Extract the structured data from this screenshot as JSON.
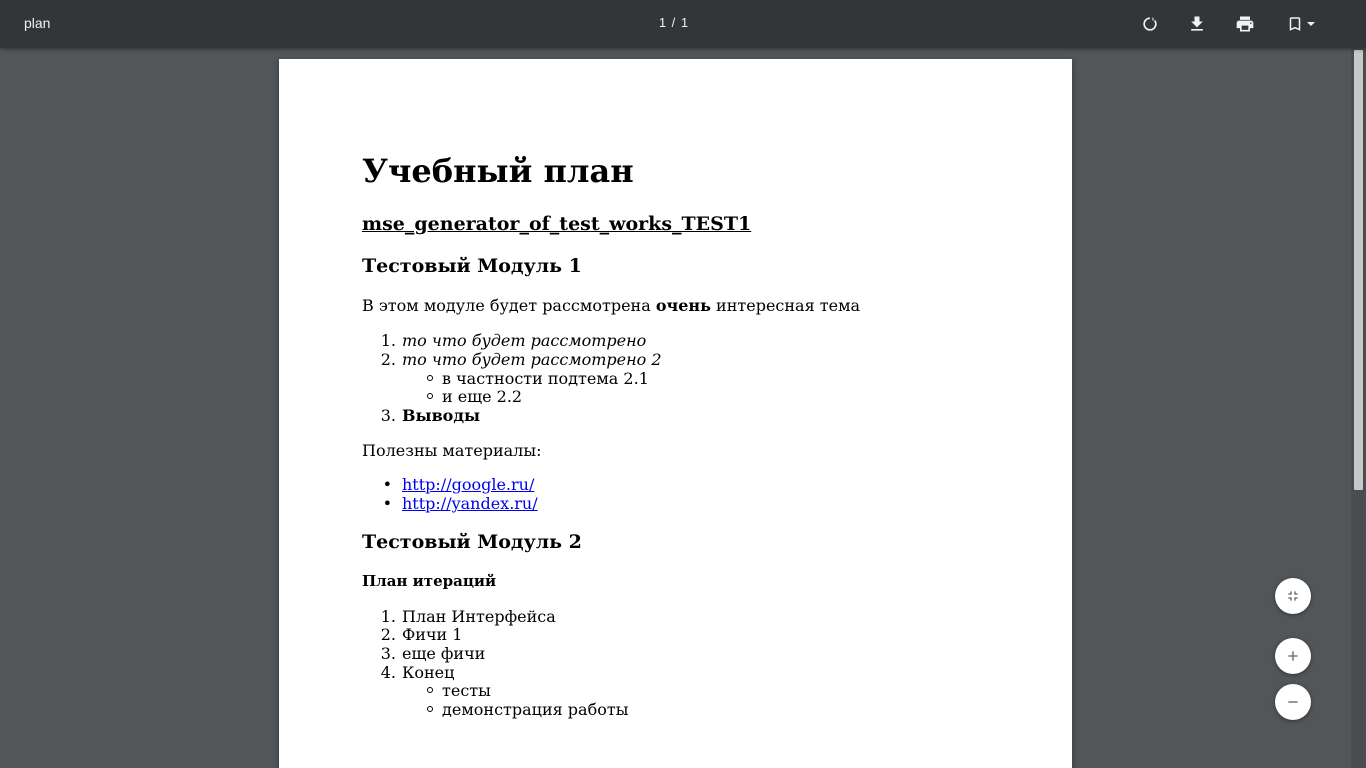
{
  "toolbar": {
    "title": "plan",
    "page_indicator": "1 / 1",
    "icons": [
      "rotate-icon",
      "download-icon",
      "print-icon",
      "bookmark-icon",
      "dropdown-arrow-icon"
    ]
  },
  "colors": {
    "toolbar_bg": "#323639",
    "viewer_bg": "#525659",
    "link": "#0000ee"
  },
  "document": {
    "title": "Учебный план",
    "course_link": "mse_generator_of_test_works_TEST1",
    "module1": {
      "heading": "Тестовый Модуль 1",
      "intro_before": "В этом модуле будет рассмотрена ",
      "intro_bold": "очень",
      "intro_after": " интересная тема",
      "items": [
        {
          "num": "1.",
          "text": "то что будет рассмотрено"
        },
        {
          "num": "2.",
          "text": "то что будет рассмотрено 2"
        },
        {
          "num": "3.",
          "text": "Выводы"
        }
      ],
      "subitems": [
        "в частности подтема 2.1",
        "и еще 2.2"
      ],
      "materials_label": "Полезны материалы:",
      "links": [
        "http://google.ru/",
        "http://yandex.ru/"
      ]
    },
    "module2": {
      "heading": "Тестовый Модуль 2",
      "subheading": "План итераций",
      "items": [
        {
          "num": "1.",
          "text": "План Интерфейса"
        },
        {
          "num": "2.",
          "text": "Фичи 1"
        },
        {
          "num": "3.",
          "text": "еще фичи"
        },
        {
          "num": "4.",
          "text": "Конец"
        }
      ],
      "subitems": [
        "тесты",
        "демонстрация работы"
      ]
    }
  },
  "controls": {
    "fit_icon": "fit-to-page-icon",
    "zoom_in_icon": "zoom-in-icon",
    "zoom_out_icon": "zoom-out-icon"
  }
}
